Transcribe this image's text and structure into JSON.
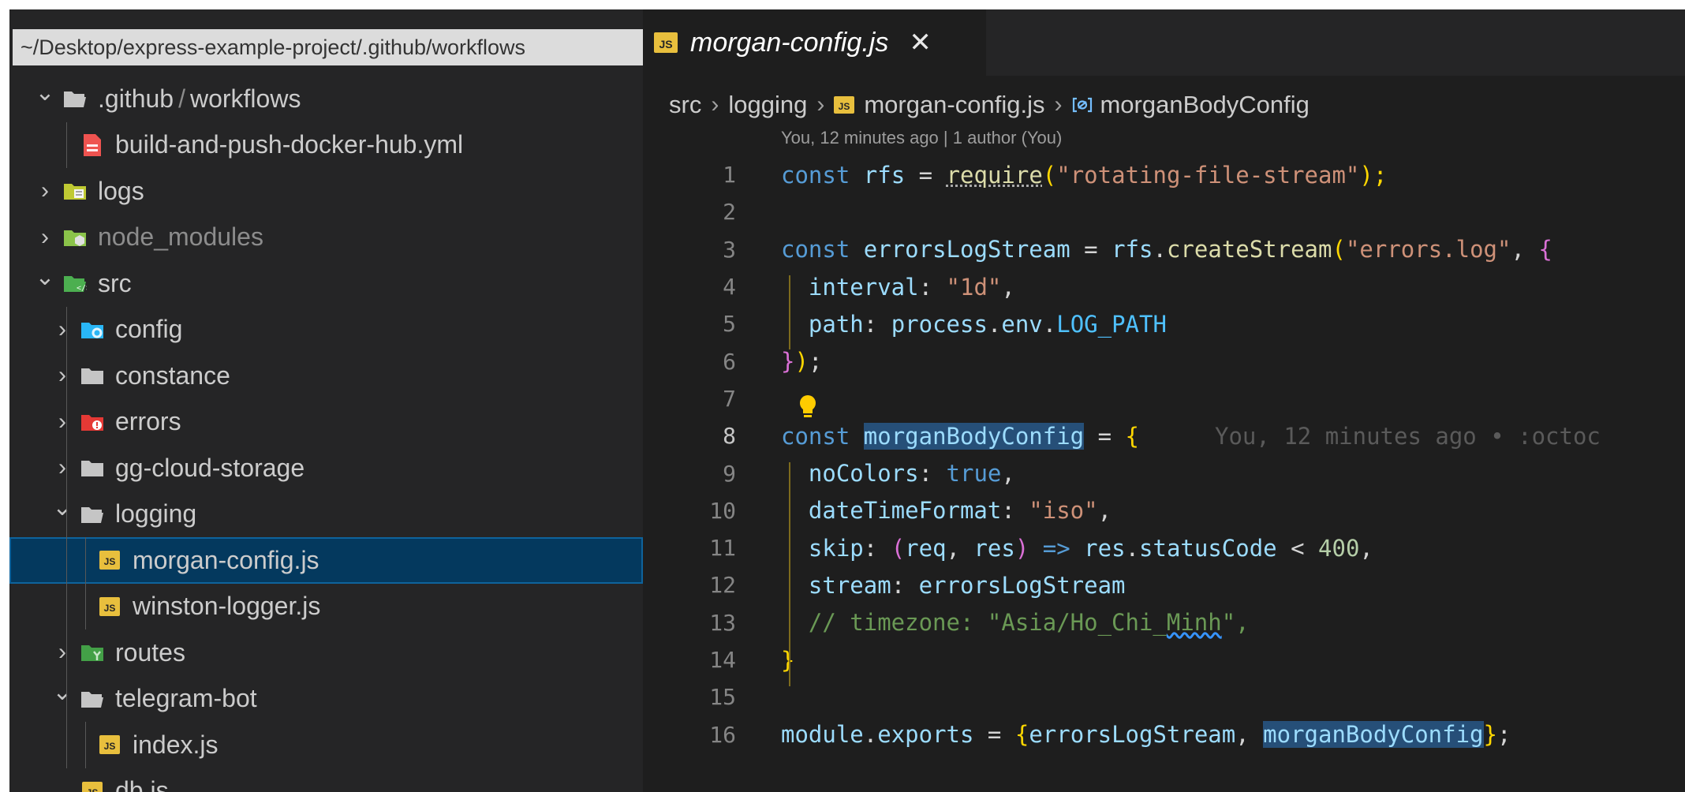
{
  "explorer": {
    "path": "~/Desktop/express-example-project/.github/workflows",
    "items": [
      {
        "label": ".github",
        "label2": "workflows",
        "kind": "folder-open",
        "depth": 0,
        "chevron": "down"
      },
      {
        "label": "build-and-push-docker-hub.yml",
        "kind": "yml",
        "depth": 1
      },
      {
        "label": "logs",
        "kind": "folder-logs",
        "depth": 0,
        "chevron": "right"
      },
      {
        "label": "node_modules",
        "kind": "folder-node",
        "depth": 0,
        "chevron": "right",
        "dim": true
      },
      {
        "label": "src",
        "kind": "folder-src",
        "depth": 0,
        "chevron": "down"
      },
      {
        "label": "config",
        "kind": "folder-config",
        "depth": 1,
        "chevron": "right"
      },
      {
        "label": "constance",
        "kind": "folder",
        "depth": 1,
        "chevron": "right"
      },
      {
        "label": "errors",
        "kind": "folder-errors",
        "depth": 1,
        "chevron": "right"
      },
      {
        "label": "gg-cloud-storage",
        "kind": "folder",
        "depth": 1,
        "chevron": "right"
      },
      {
        "label": "logging",
        "kind": "folder-open",
        "depth": 1,
        "chevron": "down"
      },
      {
        "label": "morgan-config.js",
        "kind": "js",
        "depth": 2,
        "selected": true
      },
      {
        "label": "winston-logger.js",
        "kind": "js",
        "depth": 2
      },
      {
        "label": "routes",
        "kind": "folder-routes",
        "depth": 1,
        "chevron": "right"
      },
      {
        "label": "telegram-bot",
        "kind": "folder-open",
        "depth": 1,
        "chevron": "down"
      },
      {
        "label": "index.js",
        "kind": "js",
        "depth": 2
      },
      {
        "label": "db.js",
        "kind": "js",
        "depth": 1
      }
    ]
  },
  "tab": {
    "title": "morgan-config.js",
    "icon": "JS",
    "close": "✕"
  },
  "breadcrumb": {
    "p1": "src",
    "p2": "logging",
    "p3": "morgan-config.js",
    "p4": "morganBodyConfig"
  },
  "blame_header": "You, 12 minutes ago | 1 author (You)",
  "inline_blame": "You, 12 minutes ago • :octoc",
  "code": {
    "numbers": [
      "1",
      "2",
      "3",
      "4",
      "5",
      "6",
      "7",
      "8",
      "9",
      "10",
      "11",
      "12",
      "13",
      "14",
      "15",
      "16"
    ],
    "l1": {
      "a": "const",
      "b": "rfs",
      "c": "=",
      "d": "require",
      "e": "(",
      "f": "\"rotating-file-stream\"",
      "g": ");"
    },
    "l3": {
      "a": "const",
      "b": "errorsLogStream",
      "c": "=",
      "d": "rfs",
      "e": ".",
      "f": "createStream",
      "g": "(",
      "h": "\"errors.log\"",
      "i": ", ",
      "j": "{"
    },
    "l4": {
      "a": "interval",
      "b": ": ",
      "c": "\"1d\"",
      "d": ","
    },
    "l5": {
      "a": "path",
      "b": ": ",
      "c": "process",
      "d": ".",
      "e": "env",
      "f": ".",
      "g": "LOG_PATH"
    },
    "l6": {
      "a": "}",
      "b": ")",
      "c": ";"
    },
    "l8": {
      "a": "const",
      "b": "morganBodyConfig",
      "c": "=",
      "d": "{"
    },
    "l9": {
      "a": "noColors",
      "b": ": ",
      "c": "true",
      "d": ","
    },
    "l10": {
      "a": "dateTimeFormat",
      "b": ": ",
      "c": "\"iso\"",
      "d": ","
    },
    "l11": {
      "a": "skip",
      "b": ": ",
      "c": "(",
      "d": "req",
      "e": ", ",
      "f": "res",
      "g": ")",
      "h": " => ",
      "i": "res",
      "j": ".",
      "k": "statusCode",
      "l": " < ",
      "m": "400",
      "n": ","
    },
    "l12": {
      "a": "stream",
      "b": ": ",
      "c": "errorsLogStream"
    },
    "l13": {
      "a": "// timezone: \"Asia/Ho_Chi_",
      "b": "Minh",
      "c": "\","
    },
    "l14": {
      "a": "}"
    },
    "l16": {
      "a": "module",
      "b": ".",
      "c": "exports",
      "d": "=",
      "e": "{",
      "f": "errorsLogStream",
      "g": ", ",
      "h": "morganBodyConfig",
      "i": "}",
      "j": ";"
    }
  }
}
